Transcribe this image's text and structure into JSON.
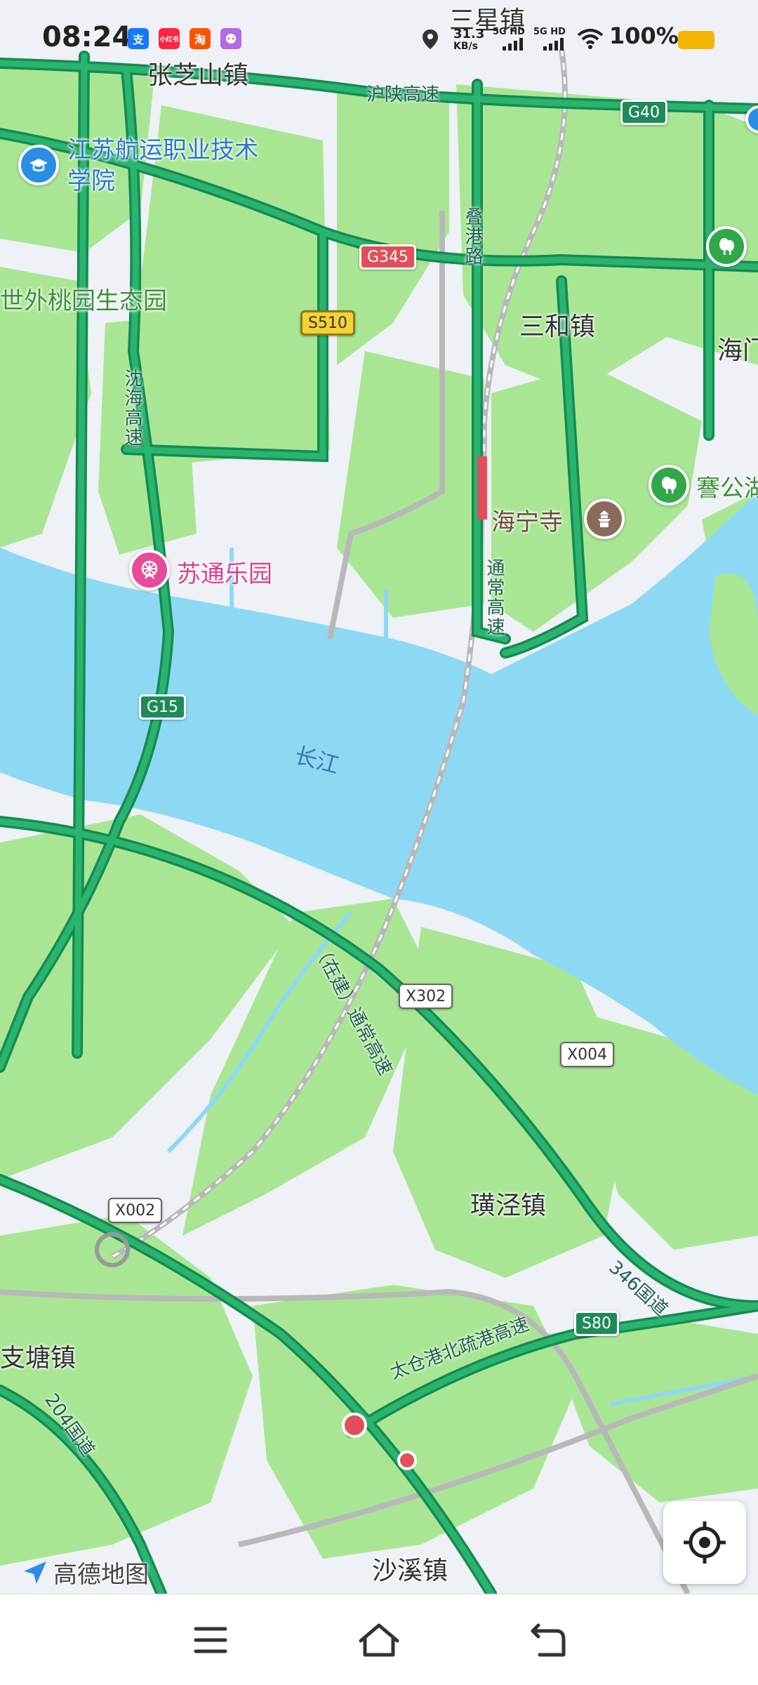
{
  "status_bar": {
    "time": "08:24",
    "app_icons": [
      {
        "name": "alipay",
        "text": "支",
        "color": "#1677ff"
      },
      {
        "name": "xiaohongshu",
        "text": "小红书",
        "color": "#ff2442"
      },
      {
        "name": "taobao",
        "text": "淘",
        "color": "#ff5000"
      },
      {
        "name": "app4",
        "text": "",
        "color": "#b36ae2"
      }
    ],
    "net_speed": "31.3",
    "net_unit": "KB/s",
    "sim1": "5G HD",
    "sim2": "5G HD",
    "battery": "100%"
  },
  "map": {
    "towns": {
      "sanxing": "三星镇",
      "zhangzhishan": "张芝山镇",
      "sanhe": "三和镇",
      "haimen": "海门",
      "huangjing": "璜泾镇",
      "zhitang": "支塘镇",
      "shaxi": "沙溪镇"
    },
    "pois": {
      "college": "江苏航运职业技术学院",
      "taoyuan": "世外桃园生态园",
      "sutong_park": "苏通乐园",
      "haining_temple": "海宁寺",
      "jiangong": "謇公湖"
    },
    "roads": {
      "hushan": "沪陕高速",
      "shengang": "沈海高速",
      "diegang": "叠港路",
      "tongchang_n": "通常高速",
      "tongchang_s": "（在建）通常高速",
      "national346": "346国道",
      "national204": "204国道",
      "taicang": "太仓港北疏港高速"
    },
    "shields": {
      "g40": "G40",
      "g345": "G345",
      "s510": "S510",
      "g15": "G15",
      "x302": "X302",
      "x004": "X004",
      "x002": "X002",
      "s80": "S80"
    },
    "water": {
      "yangtze": "长江"
    },
    "colors": {
      "water": "#8dd9f4",
      "land": "#eef1f5",
      "green": "#a9e694",
      "road": "#2ab56f",
      "road_outline": "#168a53"
    }
  },
  "branding": {
    "logo_text": "高德地图"
  },
  "controls": {
    "locate_icon": "locate-icon"
  },
  "nav_bar": {
    "menu_icon": "menu-icon",
    "home_icon": "home-icon",
    "back_icon": "back-icon"
  }
}
